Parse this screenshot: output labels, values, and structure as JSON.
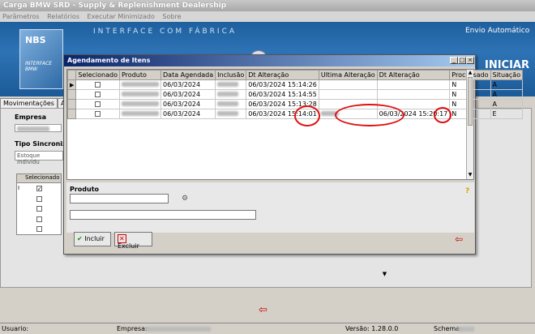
{
  "app": {
    "title": "Carga BMW SRD - Supply & Replenishment Dealership",
    "menu": [
      "Parâmetros",
      "Relatórios",
      "Executar Minimizado",
      "Sobre"
    ],
    "banner_title": "INTERFACE COM FÁBRICA",
    "banner_right": "Envio Automático",
    "iniciar": "INICIAR",
    "logo_text": "NBS",
    "logo_sub": "INTERFACE BMW"
  },
  "bg": {
    "tabs": [
      "Movimentações",
      "Au"
    ],
    "empresa_label": "Empresa",
    "tipo_label": "Tipo Sincroniz",
    "tipo_value": "Estoque Individu",
    "grid_header": "Selecionado"
  },
  "dialog": {
    "title": "Agendamento de Itens",
    "columns": [
      "Selecionado",
      "Produto",
      "Data Agendada",
      "Inclusão",
      "Dt Alteração",
      "Ultima Alteração",
      "Dt Alteração",
      "Processado",
      "Situação"
    ],
    "rows": [
      {
        "indicator": "▶",
        "data_agendada": "06/03/2024",
        "dt_alteracao": "06/03/2024 15:14:26",
        "dt_alteracao2": "",
        "processado": "N",
        "situacao": "A"
      },
      {
        "indicator": "",
        "data_agendada": "06/03/2024",
        "dt_alteracao": "06/03/2024 15:14:55",
        "dt_alteracao2": "",
        "processado": "N",
        "situacao": "A"
      },
      {
        "indicator": "",
        "data_agendada": "06/03/2024",
        "dt_alteracao": "06/03/2024 15:13:28",
        "dt_alteracao2": "",
        "processado": "N",
        "situacao": "A"
      },
      {
        "indicator": "",
        "data_agendada": "06/03/2024",
        "dt_alteracao": "06/03/2024 15:14:01",
        "dt_alteracao2": "06/03/2024 15:20:17",
        "processado": "N",
        "situacao": "E"
      }
    ],
    "produto_label": "Produto",
    "incluir": "Incluir",
    "excluir": "Excluir",
    "help": "?"
  },
  "status": {
    "usuario": "Usuario:",
    "empresa": "Empresa:",
    "versao": "Versão: 1.28.0.0",
    "schema": "Schema:"
  }
}
